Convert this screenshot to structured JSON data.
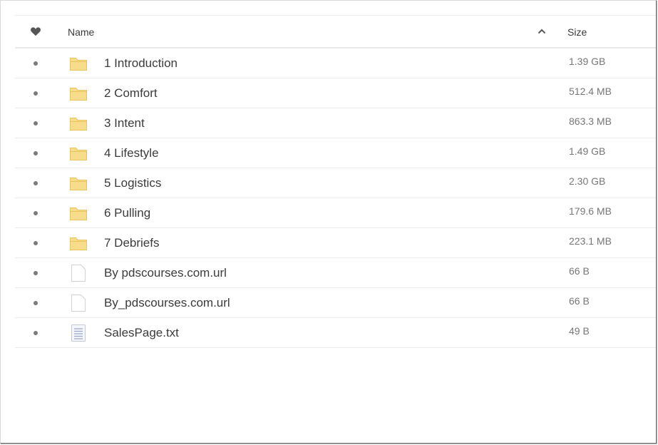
{
  "header": {
    "name_label": "Name",
    "size_label": "Size",
    "sort_direction": "ascending"
  },
  "colors": {
    "folder": "#f7dc8c",
    "folder_edge": "#e8c45a",
    "dot": "#7a7a7a"
  },
  "rows": [
    {
      "icon": "folder-icon",
      "name": "1 Introduction",
      "size": "1.39 GB"
    },
    {
      "icon": "folder-icon",
      "name": "2 Comfort",
      "size": "512.4 MB"
    },
    {
      "icon": "folder-icon",
      "name": "3 Intent",
      "size": "863.3 MB"
    },
    {
      "icon": "folder-icon",
      "name": "4 Lifestyle",
      "size": "1.49 GB"
    },
    {
      "icon": "folder-icon",
      "name": "5 Logistics",
      "size": "2.30 GB"
    },
    {
      "icon": "folder-icon",
      "name": "6 Pulling",
      "size": "179.6 MB"
    },
    {
      "icon": "folder-icon",
      "name": "7 Debriefs",
      "size": "223.1 MB"
    },
    {
      "icon": "file-icon",
      "name": "By pdscourses.com.url",
      "size": "66 B"
    },
    {
      "icon": "file-icon",
      "name": "By_pdscourses.com.url",
      "size": "66 B"
    },
    {
      "icon": "text-file-icon",
      "name": "SalesPage.txt",
      "size": "49 B"
    }
  ]
}
